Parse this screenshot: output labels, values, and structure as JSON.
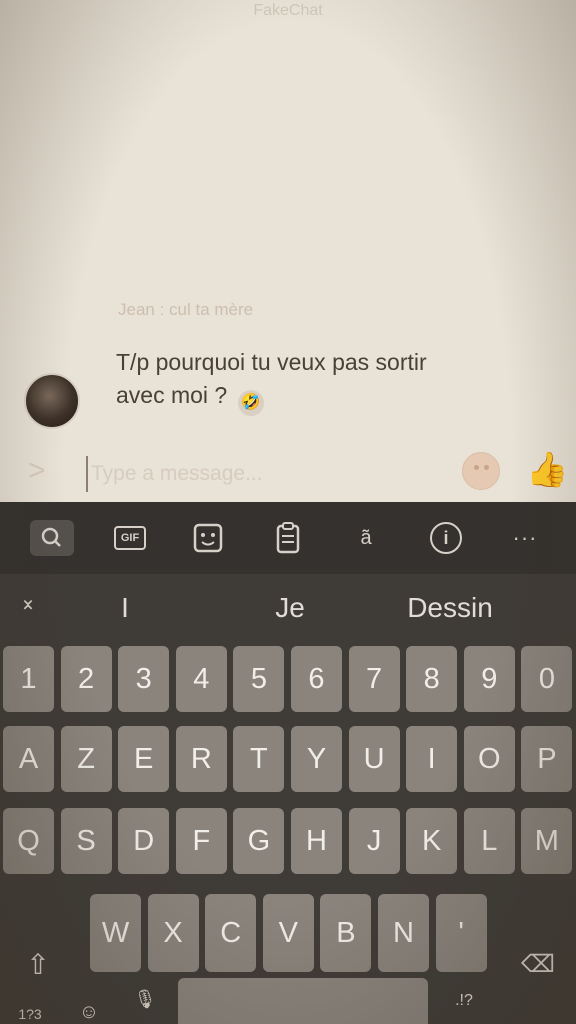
{
  "header": {
    "title": "FakeChat"
  },
  "chat": {
    "sender": "Jean : cul ta mère",
    "message": "T/p pourquoi tu veux pas sortir avec moi ?",
    "message_emoji": "🤣"
  },
  "composer": {
    "placeholder": "Type a message...",
    "expand_icon": ">",
    "like_icon": "👍"
  },
  "keyboard": {
    "toolbar": {
      "search_icon": "search-icon",
      "gif_label": "GIF",
      "sticker_icon": "sticker-icon",
      "clipboard_icon": "clipboard-icon",
      "translate_label": "a͂",
      "info_label": "i",
      "more_label": "···"
    },
    "suggestions": [
      "I",
      "Je",
      "Dessin"
    ],
    "rows": {
      "numbers": [
        "1",
        "2",
        "3",
        "4",
        "5",
        "6",
        "7",
        "8",
        "9",
        "0"
      ],
      "row1": [
        "A",
        "Z",
        "E",
        "R",
        "T",
        "Y",
        "U",
        "I",
        "O",
        "P"
      ],
      "row2": [
        "Q",
        "S",
        "D",
        "F",
        "G",
        "H",
        "J",
        "K",
        "L",
        "M"
      ],
      "row3": [
        "W",
        "X",
        "C",
        "V",
        "B",
        "N",
        "'"
      ]
    },
    "bottom": {
      "symbols_label": "1?3",
      "punct_label": ".!?"
    }
  }
}
